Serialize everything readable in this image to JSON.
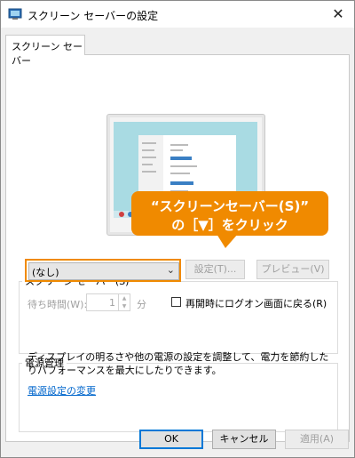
{
  "window": {
    "title": "スクリーン セーバーの設定",
    "close_glyph": "✕"
  },
  "tab": {
    "label": "スクリーン セーバー"
  },
  "callout": {
    "line1": "“スクリーンセーバー(S)”",
    "line2": "の［▼］をクリック",
    "color": "#f08a00"
  },
  "screensaver": {
    "group_label": "スクリーン セーバー(S)",
    "selected": "(なし)",
    "settings_button": "設定(T)...",
    "preview_button": "プレビュー(V)",
    "wait_label": "待ち時間(W):",
    "wait_value": "1",
    "wait_unit": "分",
    "resume_label": "再開時にログオン画面に戻る(R)",
    "resume_checked": false
  },
  "power": {
    "group_label": "電源管理",
    "description_line1": "ディスプレイの明るさや他の電源の設定を調整して、電力を節約した",
    "description_line2": "りパフォーマンスを最大にしたりできます。",
    "link": "電源設定の変更"
  },
  "footer": {
    "ok": "OK",
    "cancel": "キャンセル",
    "apply": "適用(A)"
  },
  "colors": {
    "accent": "#0078d7",
    "highlight": "#f08a00",
    "link": "#0066cc"
  }
}
